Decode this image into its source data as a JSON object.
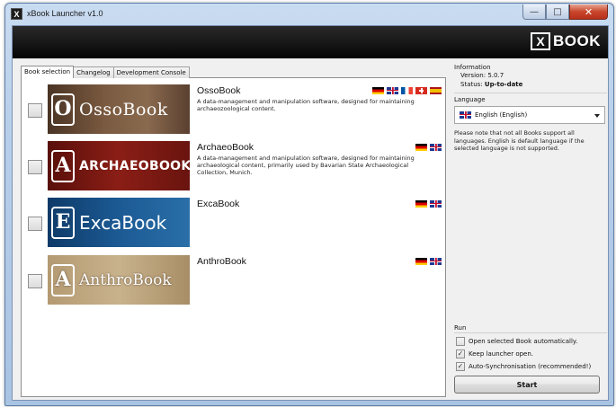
{
  "window": {
    "title": "xBook Launcher v1.0",
    "app_icon": "X",
    "controls": [
      "minimize-icon",
      "maximize-icon",
      "close-icon"
    ]
  },
  "banner": {
    "logo_box": "X",
    "logo_text": "BOOK"
  },
  "tabs": [
    {
      "label": "Book selection",
      "active": true
    },
    {
      "label": "Changelog",
      "active": false
    },
    {
      "label": "Development Console",
      "active": false
    }
  ],
  "books": [
    {
      "id": "osso",
      "banner_letter": "O",
      "banner_text": "OssoBook",
      "title": "OssoBook",
      "description": "A data-management and manipulation software, designed for maintaining archaeozoological content.",
      "flags": [
        "de",
        "gb",
        "fr",
        "ch",
        "es"
      ],
      "checked": false
    },
    {
      "id": "archaeo",
      "banner_letter": "A",
      "banner_text": "ARCHAEOBOOK",
      "title": "ArchaeoBook",
      "description": "A data-management and manipulation software, designed for maintaining archaeological content, primarily used by Bavarian State Archaeological Collection, Munich.",
      "flags": [
        "de",
        "gb"
      ],
      "checked": false
    },
    {
      "id": "exca",
      "banner_letter": "E",
      "banner_text": "ExcaBook",
      "title": "ExcaBook",
      "description": "",
      "flags": [
        "de",
        "gb"
      ],
      "checked": false
    },
    {
      "id": "anthro",
      "banner_letter": "A",
      "banner_text": "AnthroBook",
      "title": "AnthroBook",
      "description": "",
      "flags": [
        "de",
        "gb"
      ],
      "checked": false
    }
  ],
  "info": {
    "heading": "Information",
    "version_label": "Version:",
    "version_value": "5.0.7",
    "status_label": "Status:",
    "status_value": "Up-to-date"
  },
  "language": {
    "heading": "Language",
    "selected": "English (English)",
    "selected_flag": "gb",
    "note": "Please note that not all Books support all languages. English is default language if the selected language is not supported."
  },
  "run": {
    "heading": "Run",
    "options": [
      {
        "label": "Open selected Book automatically.",
        "checked": false
      },
      {
        "label": "Keep launcher open.",
        "checked": true
      },
      {
        "label": "Auto-Synchronisation (recommended!)",
        "checked": true
      }
    ],
    "start_label": "Start"
  }
}
